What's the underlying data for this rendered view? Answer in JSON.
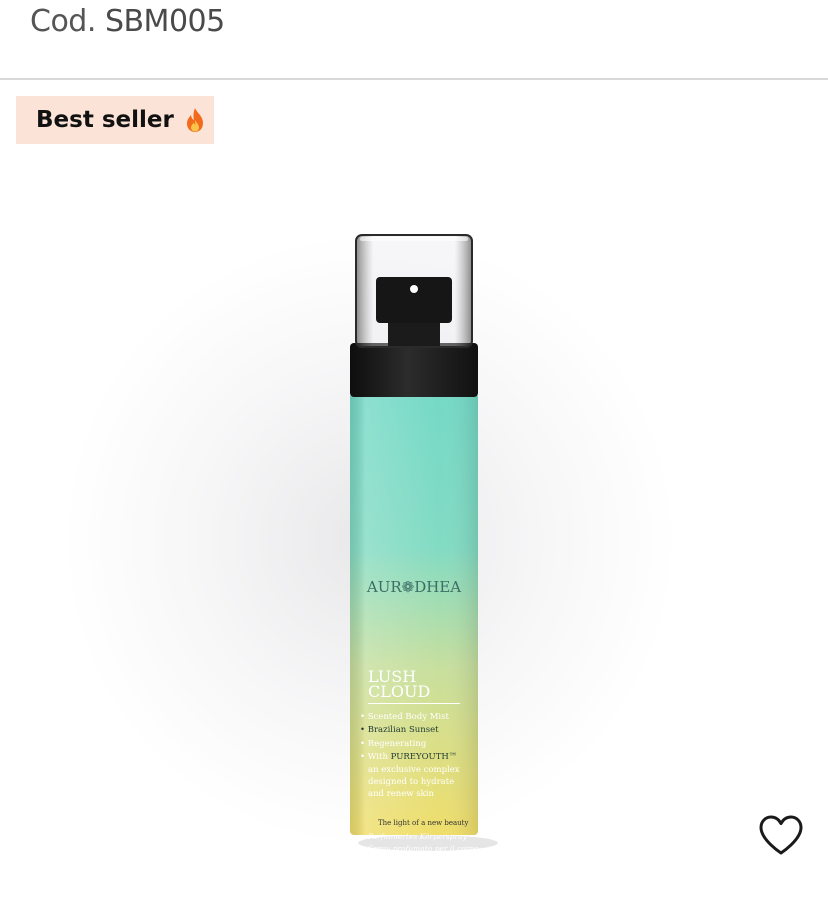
{
  "product": {
    "code_label": "Cod.",
    "code_value": "SBM005"
  },
  "badge": {
    "label": "Best seller",
    "icon": "fire-icon",
    "background": "#fbe3d8"
  },
  "packaging": {
    "brand": "AUR❁DHEA",
    "name_line1": "LUSH",
    "name_line2": "CLOUD",
    "bullet1": "Scented Body Mist",
    "bullet2": "Brazilian Sunset",
    "bullet3": "Regenerating",
    "bullet4_prefix": "With ",
    "bullet4_brand": "PUREYOUTH™",
    "desc1": "an exclusive complex",
    "desc2": "designed to hydrate",
    "desc3": "and renew skin",
    "lang1": "Parfumiertes Körperspray",
    "lang2": "Spray profumato per il corpo",
    "tagline": "The light of a new beauty"
  },
  "favorite": {
    "icon": "heart-icon"
  },
  "colors": {
    "bottle_top": "#74d9c6",
    "bottle_bottom": "#f0de6a",
    "cap": "#1e1e1e"
  }
}
